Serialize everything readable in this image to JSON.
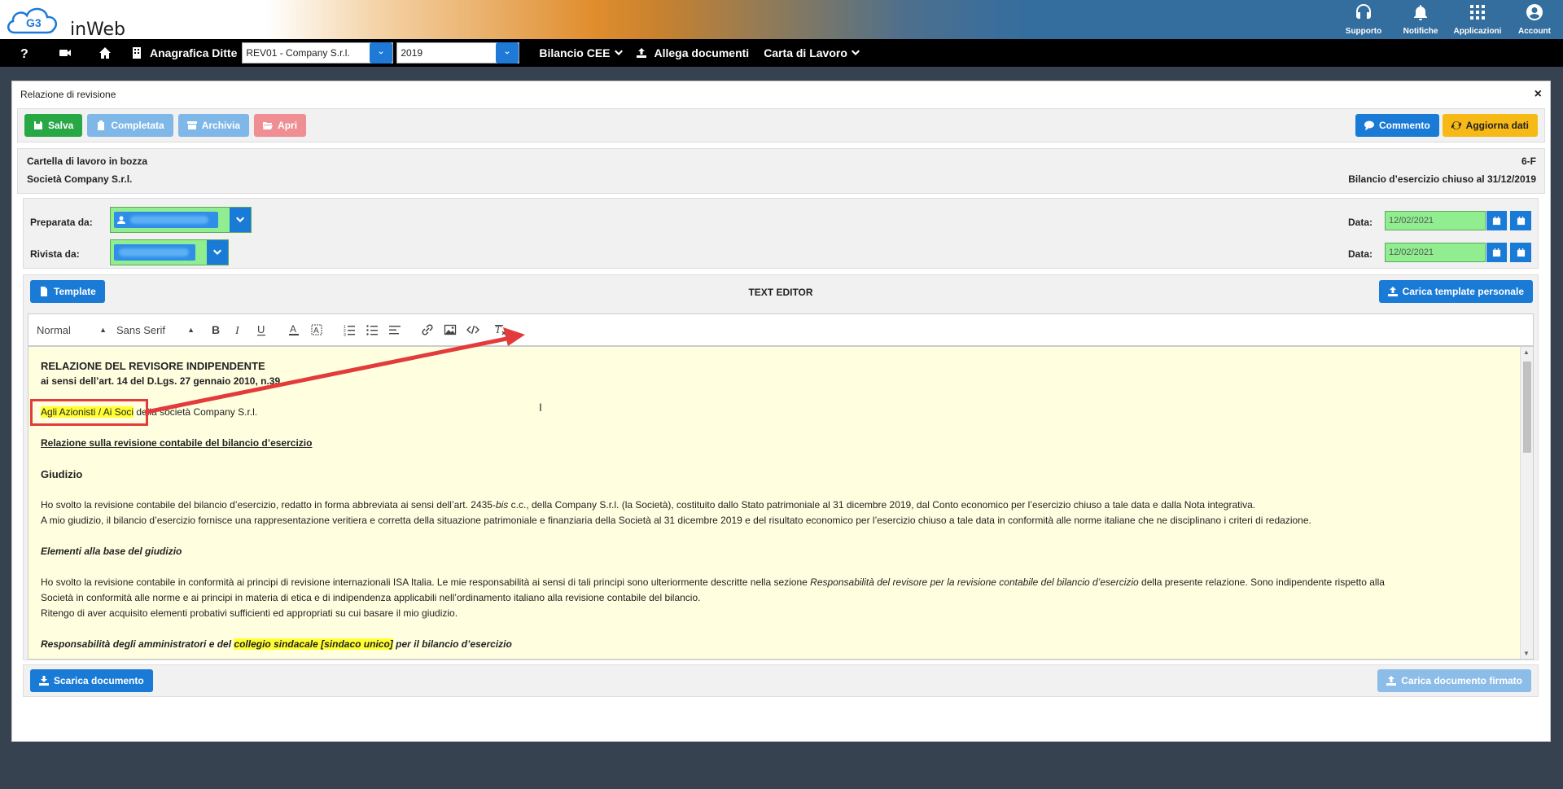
{
  "app": {
    "logo_text": "inWeb",
    "top_icons": [
      {
        "icon": "headset-icon",
        "label": "Supporto"
      },
      {
        "icon": "bell-icon",
        "label": "Notifiche"
      },
      {
        "icon": "grid-icon",
        "label": "Applicazioni"
      },
      {
        "icon": "user-circle-icon",
        "label": "Account"
      }
    ]
  },
  "nav": {
    "anagrafica_label": "Anagrafica Ditte",
    "company_select": "REV01 - Company S.r.l.",
    "year_select": "2019",
    "bilancio_label": "Bilancio CEE",
    "allega_label": "Allega documenti",
    "carta_label": "Carta di Lavoro"
  },
  "panel": {
    "title": "Relazione di revisione",
    "close": "×"
  },
  "toolbar": {
    "salva": "Salva",
    "completata": "Completata",
    "archivia": "Archivia",
    "apri": "Apri",
    "commento": "Commento",
    "aggiorna": "Aggiorna dati"
  },
  "info": {
    "status": "Cartella di lavoro in bozza",
    "company": "Società Company S.r.l.",
    "code": "6-F",
    "period": "Bilancio d’esercizio chiuso al 31/12/2019"
  },
  "people": {
    "preparata_label": "Preparata da:",
    "rivista_label": "Rivista da:",
    "data_label": "Data:",
    "preparata_date": "12/02/2021",
    "rivista_date": "12/02/2021"
  },
  "editor": {
    "template_button": "Template",
    "title": "TEXT EDITOR",
    "carica_template": "Carica template personale",
    "format_select": "Normal",
    "font_select": "Sans Serif",
    "content": {
      "h1": "RELAZIONE DEL REVISORE INDIPENDENTE",
      "h2": "ai sensi dell’art. 14 del D.Lgs. 27 gennaio 2010, n.39",
      "recipients_hl": "Agli Azionisti / Ai Soci",
      "recipients_rest": " della società Company S.r.l.",
      "section1": "Relazione sulla revisione contabile del bilancio d’esercizio",
      "giudizio": "Giudizio",
      "p1a": "Ho svolto la revisione contabile del bilancio d’esercizio, redatto in forma abbreviata ai sensi dell’art. 2435-",
      "p1_bis": "bis",
      "p1b": " c.c., della Company S.r.l. (la Società), costituito dallo Stato patrimoniale al 31 dicembre 2019, dal Conto economico per l’esercizio chiuso a tale data e dalla Nota integrativa.",
      "p2": "A mio giudizio, il bilancio d’esercizio fornisce una rappresentazione veritiera e corretta della situazione patrimoniale e finanziaria della Società al 31 dicembre 2019 e del risultato economico per l’esercizio chiuso a tale data in conformità alle norme italiane che ne disciplinano i criteri di redazione.",
      "elementi": "Elementi alla base del giudizio",
      "p3a": "Ho svolto la revisione contabile in conformità ai principi di revisione internazionali ISA Italia. Le mie responsabilità ai sensi di tali principi sono ulteriormente descritte nella sezione ",
      "p3_italic": "Responsabilità del revisore per la revisione contabile del bilancio d’esercizio",
      "p3b": " della presente relazione. Sono indipendente rispetto alla",
      "p3c": "Società in conformità alle norme e ai principi in materia di etica e di indipendenza applicabili nell’ordinamento italiano alla revisione contabile del bilancio.",
      "p4": "Ritengo di aver acquisito elementi probativi sufficienti ed appropriati su cui basare il mio giudizio.",
      "resp_a": "Responsabilità degli amministratori e del ",
      "resp_hl": "collegio sindacale [sindaco unico]",
      "resp_b": " per il bilancio d’esercizio"
    }
  },
  "footer": {
    "scarica": "Scarica documento",
    "carica_firmato": "Carica documento firmato"
  },
  "colors": {
    "accent": "#1a7bd7",
    "success": "#28a745",
    "warning": "#f7b916",
    "annotation": "#e33b3b",
    "highlight": "#ffff33",
    "editor_bg": "#ffffe0"
  }
}
